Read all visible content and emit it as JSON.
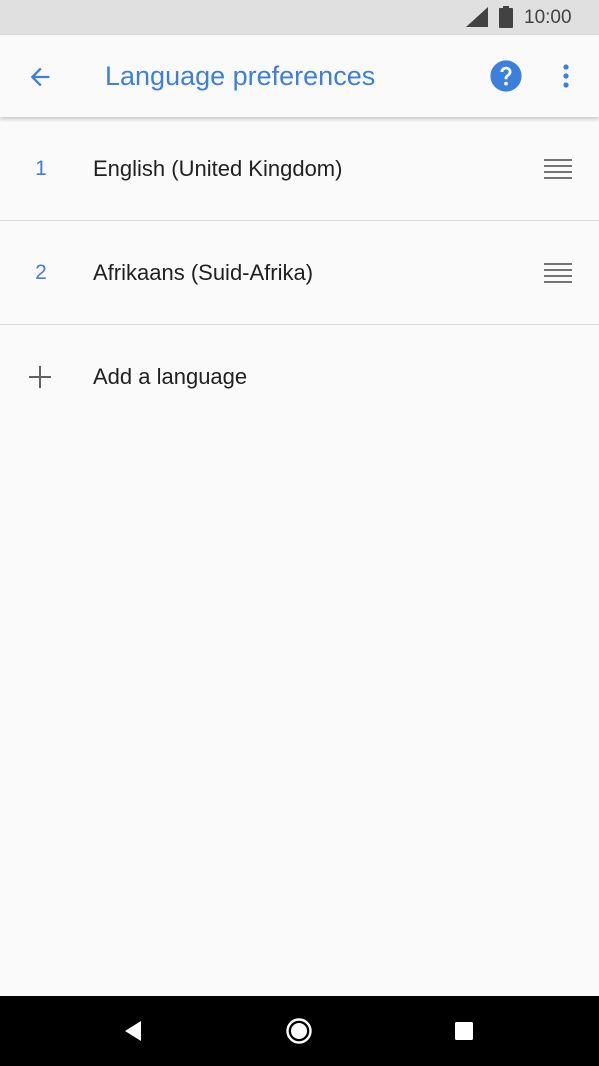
{
  "status_bar": {
    "time": "10:00",
    "icons": [
      "cell-signal-icon",
      "battery-icon"
    ]
  },
  "app_bar": {
    "title": "Language preferences",
    "back_icon": "arrow-back-icon",
    "help_icon": "help-icon",
    "more_icon": "more-vert-icon"
  },
  "languages": [
    {
      "order": "1",
      "name": "English (United Kingdom)",
      "handle_icon": "drag-handle-icon"
    },
    {
      "order": "2",
      "name": "Afrikaans (Suid-Afrika)",
      "handle_icon": "drag-handle-icon"
    }
  ],
  "add_language": {
    "label": "Add a language",
    "icon": "plus-icon"
  },
  "nav_bar": {
    "icons": [
      "nav-back-icon",
      "nav-home-icon",
      "nav-recents-icon"
    ]
  },
  "colors": {
    "accent": "#3d7fdc",
    "text_primary": "#212121",
    "status_bar_bg": "#e0e0e0",
    "nav_bar_bg": "#000000",
    "background": "#fafafa"
  }
}
